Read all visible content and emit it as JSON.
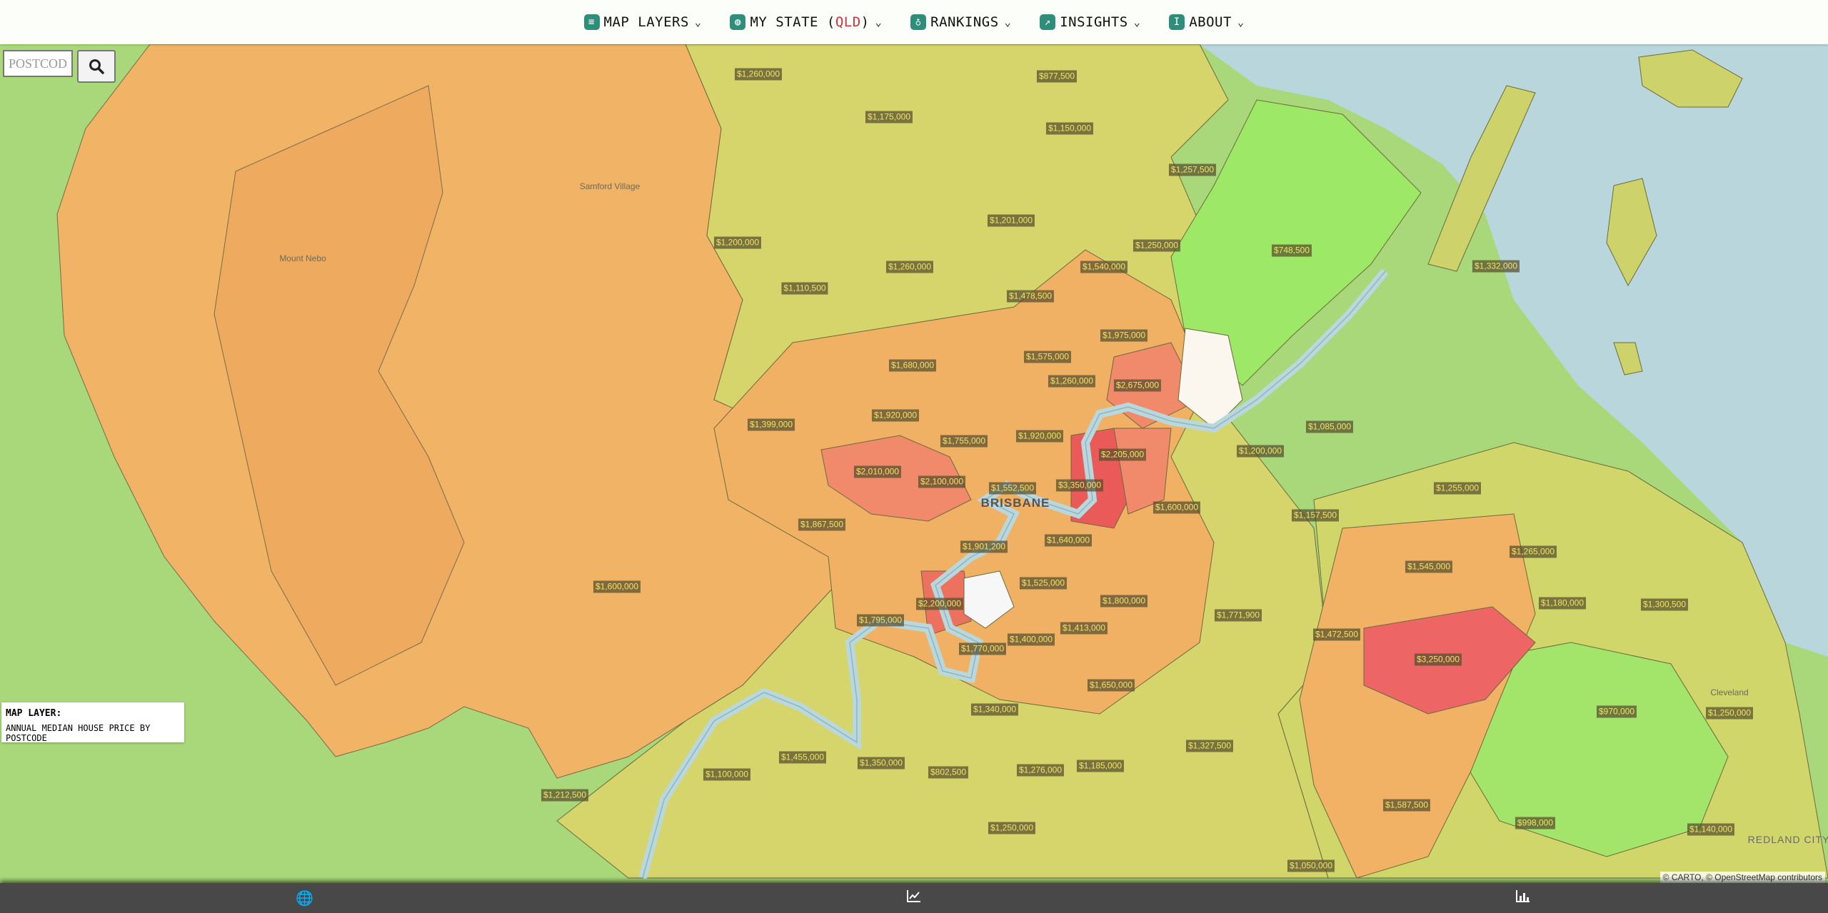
{
  "nav": [
    {
      "label": "MAP LAYERS",
      "icon": "layers-icon"
    },
    {
      "label": "MY STATE (",
      "state": "QLD",
      "suffix": ")",
      "icon": "globe-icon"
    },
    {
      "label": "RANKINGS",
      "icon": "medal-icon"
    },
    {
      "label": "INSIGHTS",
      "icon": "chart-icon"
    },
    {
      "label": "ABOUT",
      "icon": "info-icon"
    }
  ],
  "search": {
    "placeholder": "POSTCODE"
  },
  "layer": {
    "title": "MAP LAYER:",
    "value": "ANNUAL MEDIAN HOUSE PRICE BY POSTCODE"
  },
  "attribution": "© CARTO, © OpenStreetMap contributors",
  "places": {
    "brisbane": "BRISBANE",
    "samford": "Samford Village",
    "nebo": "Mount Nebo",
    "cleveland": "Cleveland",
    "redland": "REDLAND CITY"
  },
  "prices": [
    "$1,260,000",
    "$877,500",
    "$1,175,000",
    "$1,150,000",
    "$1,257,500",
    "$1,201,000",
    "$1,250,000",
    "$1,200,000",
    "$1,260,000",
    "$1,540,000",
    "$748,500",
    "$1,332,000",
    "$1,110,500",
    "$1,478,500",
    "$1,975,000",
    "$1,680,000",
    "$1,575,000",
    "$1,260,000",
    "$2,675,000",
    "$1,920,000",
    "$1,755,000",
    "$1,920,000",
    "$2,205,000",
    "$1,399,000",
    "$2,010,000",
    "$2,100,000",
    "$1,552,500",
    "$3,350,000",
    "$1,200,000",
    "$1,085,000",
    "$1,600,000",
    "$1,255,000",
    "$1,157,500",
    "$1,867,500",
    "$1,901,200",
    "$1,640,000",
    "$1,600,000",
    "$1,525,000",
    "$1,545,000",
    "$1,265,000",
    "$1,771,900",
    "$1,800,000",
    "$2,200,000",
    "$1,795,000",
    "$1,413,000",
    "$1,180,000",
    "$1,300,500",
    "$1,472,500",
    "$1,400,000",
    "$1,770,000",
    "$3,250,000",
    "$1,650,000",
    "$1,340,000",
    "$970,000",
    "$1,250,000",
    "$1,327,500",
    "$1,100,000",
    "$1,455,000",
    "$1,350,000",
    "$802,500",
    "$1,276,000",
    "$1,185,000",
    "$1,212,500",
    "$1,587,500",
    "$998,000",
    "$1,250,000",
    "$1,140,000",
    "$1,050,000"
  ],
  "colors": {
    "green": "#9de866",
    "yellowgreen": "#d6d76b",
    "orange": "#f2b062",
    "salmon": "#f08868",
    "red": "#ee6a63",
    "water": "#b7d9df"
  }
}
